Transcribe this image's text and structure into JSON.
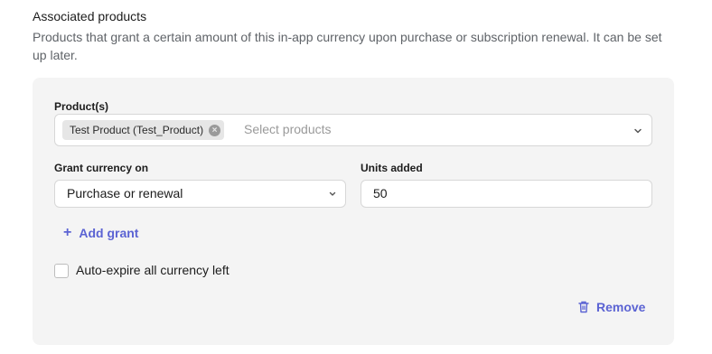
{
  "section": {
    "title": "Associated products",
    "description": "Products that grant a certain amount of this in-app currency upon purchase or subscription renewal. It can be set up later."
  },
  "products": {
    "label": "Product(s)",
    "chip": "Test Product (Test_Product)",
    "placeholder": "Select products"
  },
  "grant": {
    "label": "Grant currency on",
    "value": "Purchase or renewal"
  },
  "units": {
    "label": "Units added",
    "value": "50"
  },
  "actions": {
    "add_grant": "Add grant",
    "remove": "Remove"
  },
  "auto_expire": {
    "label": "Auto-expire all currency left",
    "checked": false
  },
  "colors": {
    "accent": "#5b63d3",
    "panel": "#f4f4f4"
  },
  "icons": [
    "plus-icon",
    "close-icon",
    "chevron-down-icon",
    "trash-icon"
  ]
}
